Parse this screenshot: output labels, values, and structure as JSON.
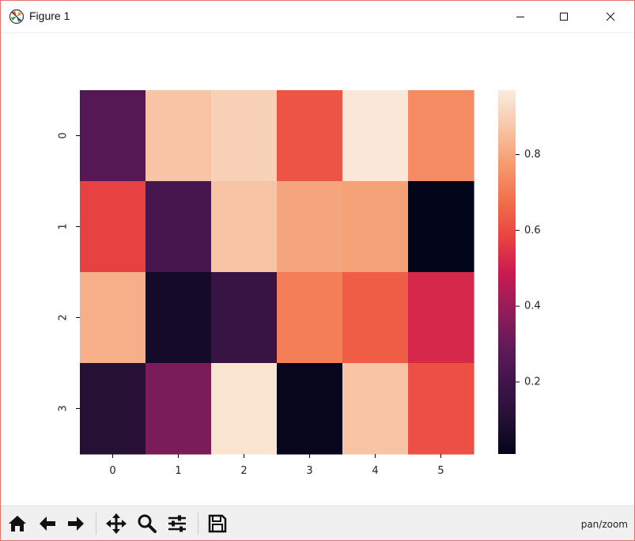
{
  "window": {
    "title": "Figure 1",
    "controls": [
      "minimize",
      "maximize",
      "close"
    ]
  },
  "toolbar": {
    "buttons": [
      {
        "name": "home-icon"
      },
      {
        "name": "back-icon"
      },
      {
        "name": "forward-icon"
      },
      {
        "name": "pan-icon"
      },
      {
        "name": "zoom-icon"
      },
      {
        "name": "configure-subplots-icon"
      },
      {
        "name": "save-icon"
      }
    ],
    "status": "pan/zoom"
  },
  "chart_data": {
    "type": "heatmap",
    "x_ticks": [
      "0",
      "1",
      "2",
      "3",
      "4",
      "5"
    ],
    "y_ticks": [
      "0",
      "1",
      "2",
      "3"
    ],
    "values": [
      [
        0.26,
        0.87,
        0.9,
        0.62,
        0.96,
        0.74
      ],
      [
        0.58,
        0.22,
        0.87,
        0.8,
        0.79,
        0.01
      ],
      [
        0.82,
        0.06,
        0.17,
        0.71,
        0.64,
        0.52
      ],
      [
        0.11,
        0.34,
        0.95,
        0.02,
        0.87,
        0.61
      ]
    ],
    "colormap": "rocket",
    "colorbar": {
      "range": [
        0.01,
        0.97
      ],
      "ticks": [
        0.2,
        0.4,
        0.6,
        0.8
      ],
      "tick_labels": [
        "0.2",
        "0.4",
        "0.6",
        "0.8"
      ]
    },
    "title": "",
    "xlabel": "",
    "ylabel": ""
  }
}
